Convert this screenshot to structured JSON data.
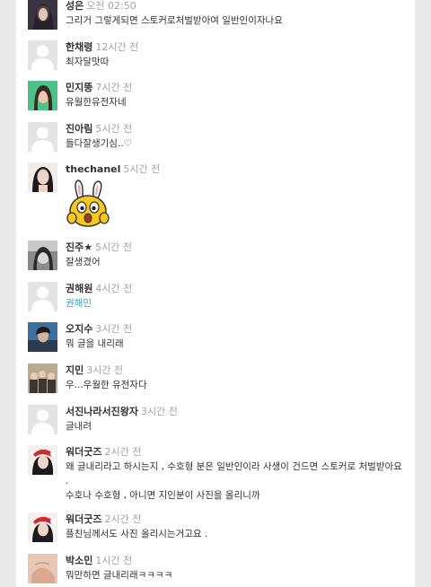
{
  "comments": [
    {
      "name": "성은",
      "time": "오전 02:50",
      "text": "그리거 그렇게되면 스토커로처벌받아여 일반인이자나요",
      "avatar": "photo-dark"
    },
    {
      "name": "한채령",
      "time": "12시간 전",
      "text": "최자달맛따",
      "avatar": "default"
    },
    {
      "name": "민지뚱",
      "time": "7시간 전",
      "text": "유월한유전자네",
      "avatar": "photo-green"
    },
    {
      "name": "진아림",
      "time": "5시간 전",
      "text": "들다잘생기심..♡",
      "avatar": "default"
    },
    {
      "name": "thechanel",
      "time": "5시간 전",
      "text": "",
      "avatar": "photo-woman",
      "sticker": "bunny-sticker"
    },
    {
      "name": "진주★",
      "time": "5시간 전",
      "text": "잘생겼어",
      "avatar": "photo-bw"
    },
    {
      "name": "권해원",
      "time": "4시간 전",
      "text": "권해인",
      "avatar": "default",
      "link": true
    },
    {
      "name": "오지수",
      "time": "3시간 전",
      "text": "뭐 글을 내리래",
      "avatar": "photo-blue"
    },
    {
      "name": "지민",
      "time": "3시간 전",
      "text": "우...우월한 유전자다",
      "avatar": "photo-group"
    },
    {
      "name": "서진나라서진왕자",
      "time": "3시간 전",
      "text": "글내려",
      "avatar": "default"
    },
    {
      "name": "워더굿즈",
      "time": "2시간 전",
      "text": "왜 글내리라고 하시는지 , 수호형 분은 일반인이라 사생이 건드면 스토커로 처벌받아요 .\n수호나 수호형 , 아니면 지인분이 사진을 올리니까",
      "avatar": "photo-santa"
    },
    {
      "name": "워더굿즈",
      "time": "2시간 전",
      "text": "플친님께서도 사진 올리시는거고요 .",
      "avatar": "photo-santa"
    },
    {
      "name": "박소민",
      "time": "1시간 전",
      "text": "뭐만하면 글내리래ㅋㅋㅋㅋ",
      "avatar": "photo-hand"
    }
  ]
}
